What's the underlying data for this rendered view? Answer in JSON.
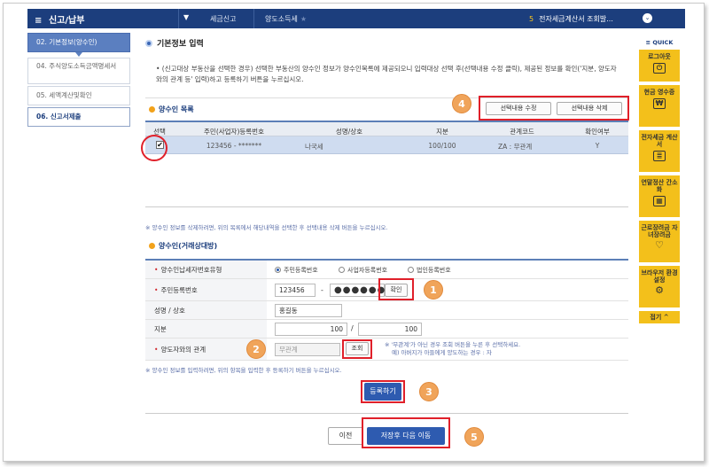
{
  "topnav": {
    "menu_label": "신고/납부",
    "breadcrumb1": "세금신고",
    "breadcrumb2": "양도소득세",
    "right_num": "5",
    "right_label": "전자세금계산서 조회발..."
  },
  "steps": [
    {
      "label": "02. 기본정보(양수인)"
    },
    {
      "label": "04. 주식양도소득금액명세서"
    },
    {
      "label": "05. 세액계산및확인"
    },
    {
      "label": "06. 신고서제출"
    }
  ],
  "page": {
    "title": "기본정보 입력",
    "notice": "• (신고대상 부동산을 선택한 경우) 선택한 부동산의 양수인 정보가 양수인목록에 제공되오니 입력대상 선택 후(선택내용 수정 클릭), 제공된 정보를 확인('지분, 양도자와의 관계 등' 입력)하고 등록하기 버튼을 누르십시오."
  },
  "list": {
    "heading": "양수인 목록",
    "edit_button": "선택내용 수정",
    "delete_button": "선택내용 삭제",
    "columns": [
      "선택",
      "주민(사업자)등록번호",
      "성명/상호",
      "지분",
      "관계코드",
      "확인여부"
    ],
    "rows": [
      {
        "checked": "✔",
        "id": "123456 - *******",
        "name": "나국세",
        "share": "100/100",
        "relation": "ZA : 무관계",
        "confirmed": "Y"
      }
    ],
    "note": "※ 양수인 정보를 삭제하려면, 위의 목록에서 해당내역을 선택한 후 선택내용 삭제 버튼을 누르십시오."
  },
  "form": {
    "heading": "양수인(거래상대방)",
    "type_label": "양수인납세자번호유형",
    "type_options": [
      "주민등록번호",
      "사업자등록번호",
      "법인등록번호"
    ],
    "id_label": "주민등록번호",
    "id_front": "123456",
    "id_dash": "-",
    "id_back": "●●●●●●●",
    "confirm_button": "확인",
    "name_label": "성명 / 상호",
    "name_value": "홍길동",
    "share_label": "지분",
    "share_num": "100",
    "share_slash": "/",
    "share_den": "100",
    "relation_label": "양도자와의 관계",
    "relation_value": "무관계",
    "lookup_button": "조회",
    "relation_hint1": "※ '무관계'가 아닌 경우 조회 버튼을 누른 후 선택하세요.",
    "relation_hint2": "예) 아버지가 아들에게 양도하는 경우 : 자",
    "note": "※ 양수인 정보를 입력하려면, 위의 항목을 입력한 후 등록하기 버튼을 누르십시오.",
    "register_button": "등록하기"
  },
  "footer": {
    "prev_button": "이전",
    "next_button": "저장후 다음 이동"
  },
  "badges": {
    "b1": "1",
    "b2": "2",
    "b3": "3",
    "b4": "4",
    "b5": "5"
  },
  "quick": {
    "header": "≡ QUICK",
    "items": [
      {
        "label": "로그아웃",
        "icon": "logout-icon"
      },
      {
        "label": "현금 영수증",
        "icon": "receipt-icon"
      },
      {
        "label": "전자세금 계산서",
        "icon": "invoice-icon"
      },
      {
        "label": "연말정산 간소화",
        "icon": "calc-icon"
      },
      {
        "label": "근로장려금 자녀장려금",
        "icon": "heart-icon"
      },
      {
        "label": "브라우저 환경설정",
        "icon": "gear-icon"
      }
    ],
    "top_label": "접기 ^"
  },
  "colors": {
    "nav": "#1c3e7d",
    "accent": "#2e5bb0",
    "highlight": "#e0202a",
    "badge": "#f0a45a",
    "quick": "#f3c01b"
  }
}
